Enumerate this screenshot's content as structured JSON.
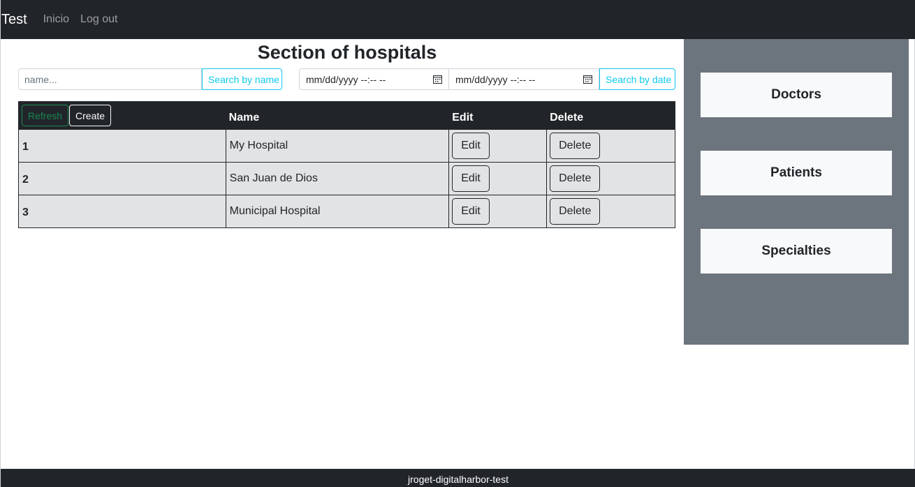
{
  "navbar": {
    "brand": "Test",
    "links": [
      "Inicio",
      "Log out"
    ]
  },
  "main": {
    "title": "Section of hospitals",
    "search_name": {
      "placeholder": "name...",
      "button_label": "Search by name"
    },
    "search_date": {
      "from_value": "mm/dd/yyyy --:-- --",
      "to_value": "mm/dd/yyyy --:-- --",
      "button_label": "Search by date"
    },
    "table": {
      "refresh_label": "Refresh",
      "create_label": "Create",
      "columns": [
        "Name",
        "Edit",
        "Delete"
      ],
      "edit_label": "Edit",
      "delete_label": "Delete",
      "rows": [
        {
          "id": "1",
          "name": "My Hospital"
        },
        {
          "id": "2",
          "name": "San Juan de Dios"
        },
        {
          "id": "3",
          "name": "Municipal Hospital"
        }
      ]
    }
  },
  "sidebar": {
    "items": [
      "Doctors",
      "Patients",
      "Specialties"
    ]
  },
  "footer": {
    "text": "jroget-digitalharbor-test"
  },
  "colors": {
    "dark": "#212529",
    "secondary": "#6c757d",
    "info": "#0dcaf0",
    "success": "#198754",
    "light": "#f8f9fa",
    "row_bg": "#e2e3e5"
  },
  "icons": {
    "date_picker": "calendar-icon"
  }
}
